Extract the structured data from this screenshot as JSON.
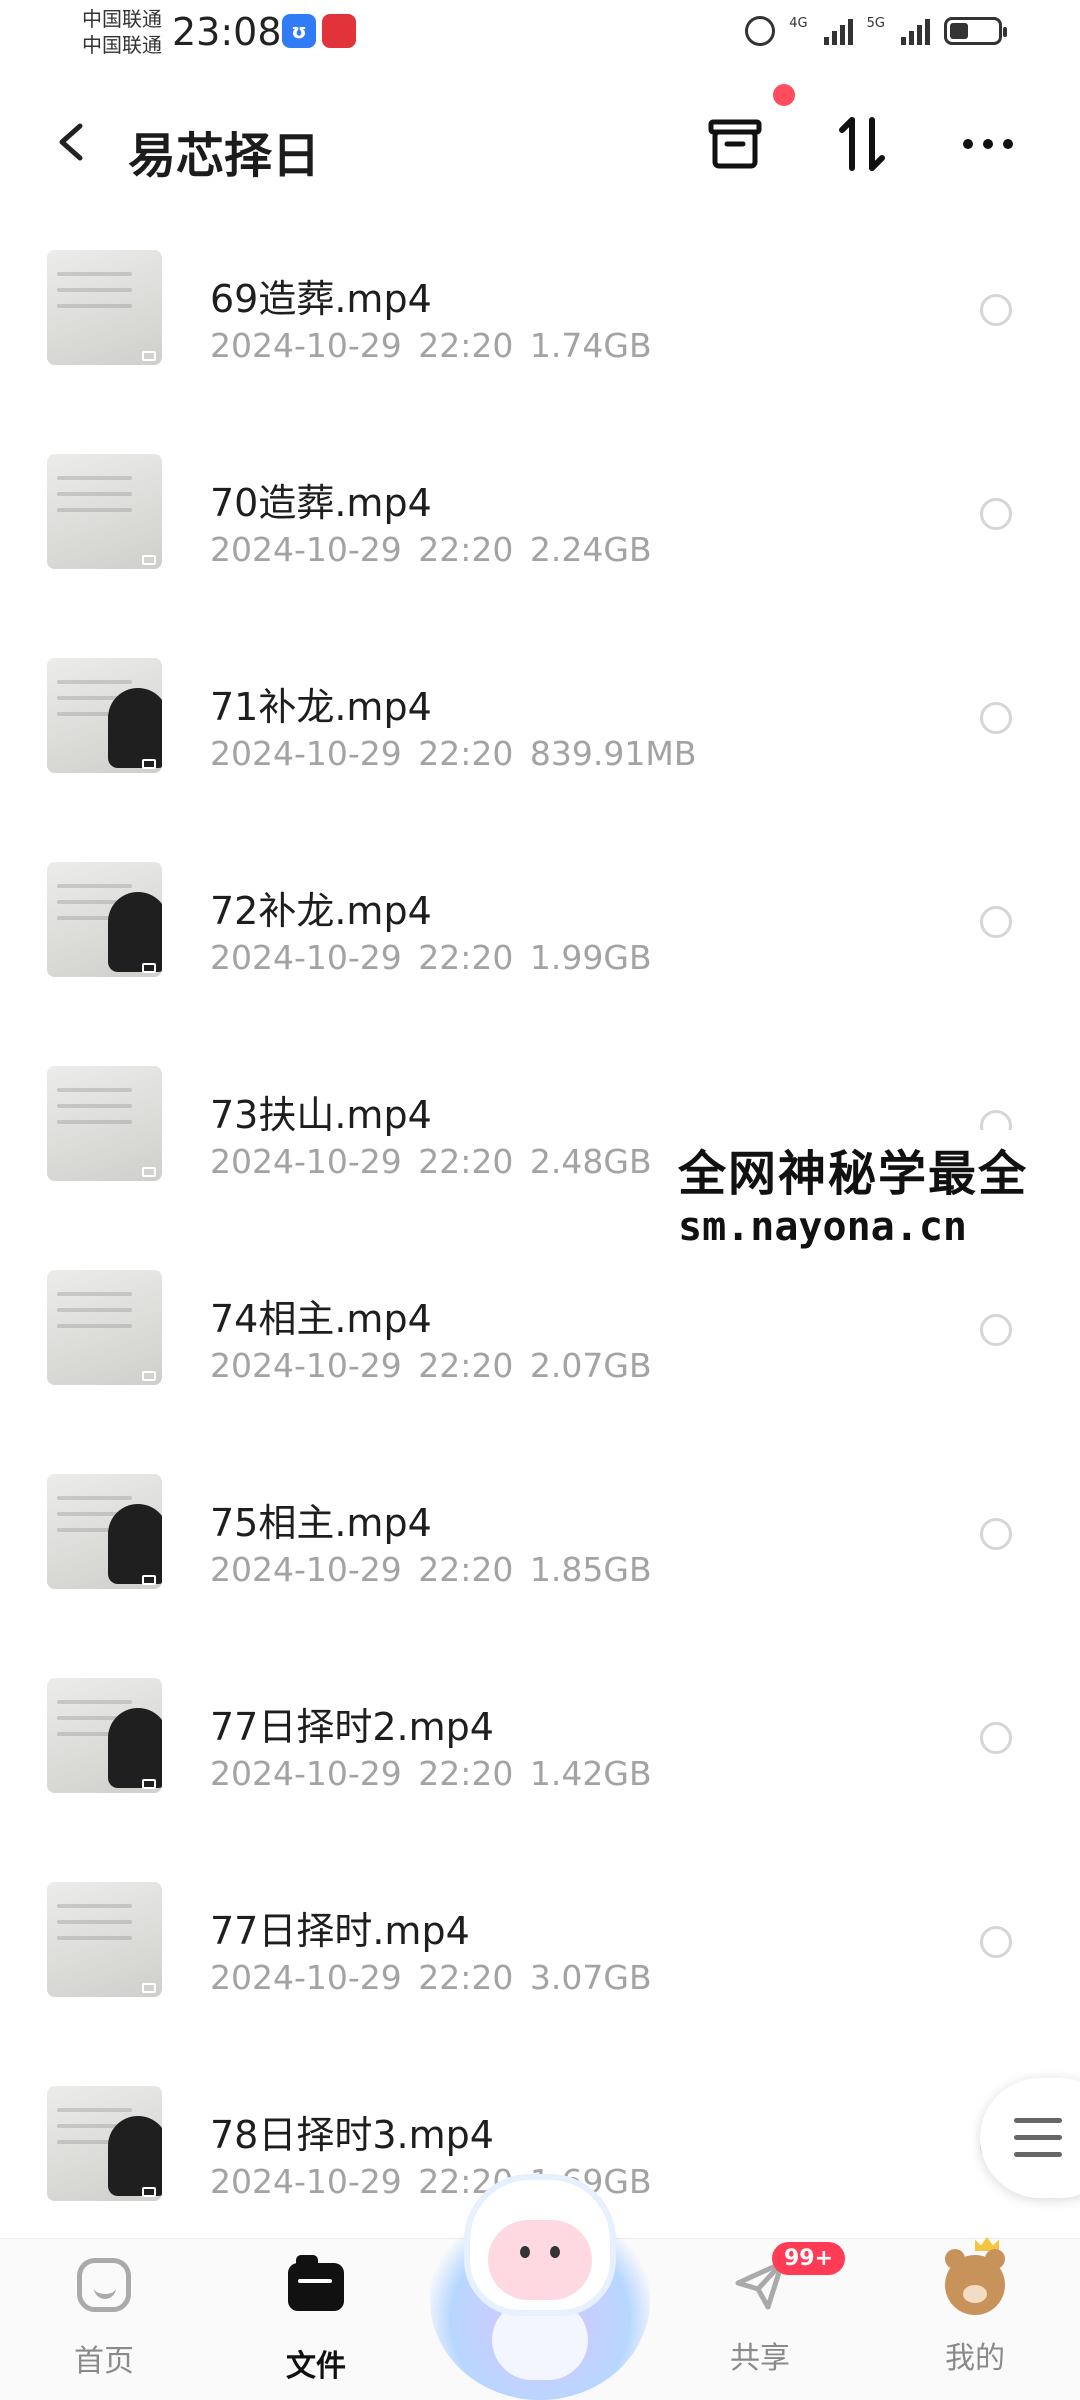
{
  "status_bar": {
    "carrier_1": "中国联通",
    "carrier_2": "中国联通",
    "time": "23:08",
    "network_1": "4G",
    "network_2": "5G",
    "battery_level": 0.35,
    "icons": [
      "alarm-icon",
      "signal-icon",
      "battery-icon"
    ]
  },
  "header": {
    "title": "易芯择日",
    "icons": [
      "back-icon",
      "archive-icon",
      "sort-icon",
      "more-icon"
    ],
    "notification_dot_color": "#ff4d5e"
  },
  "files": [
    {
      "name": "69造葬.mp4",
      "date": "2024-10-29",
      "time": "22:20",
      "size": "1.74GB",
      "thumb": "board"
    },
    {
      "name": "70造葬.mp4",
      "date": "2024-10-29",
      "time": "22:20",
      "size": "2.24GB",
      "thumb": "board"
    },
    {
      "name": "71补龙.mp4",
      "date": "2024-10-29",
      "time": "22:20",
      "size": "839.91MB",
      "thumb": "person"
    },
    {
      "name": "72补龙.mp4",
      "date": "2024-10-29",
      "time": "22:20",
      "size": "1.99GB",
      "thumb": "person"
    },
    {
      "name": "73扶山.mp4",
      "date": "2024-10-29",
      "time": "22:20",
      "size": "2.48GB",
      "thumb": "board"
    },
    {
      "name": "74相主.mp4",
      "date": "2024-10-29",
      "time": "22:20",
      "size": "2.07GB",
      "thumb": "board"
    },
    {
      "name": "75相主.mp4",
      "date": "2024-10-29",
      "time": "22:20",
      "size": "1.85GB",
      "thumb": "person"
    },
    {
      "name": "77日择时2.mp4",
      "date": "2024-10-29",
      "time": "22:20",
      "size": "1.42GB",
      "thumb": "person"
    },
    {
      "name": "77日择时.mp4",
      "date": "2024-10-29",
      "time": "22:20",
      "size": "3.07GB",
      "thumb": "board"
    },
    {
      "name": "78日择时3.mp4",
      "date": "2024-10-29",
      "time": "22:20",
      "size": "1.69GB",
      "thumb": "person"
    }
  ],
  "watermark": {
    "line1": "全网神秘学最全",
    "line2": "sm.nayona.cn"
  },
  "bottom_nav": {
    "items": [
      {
        "label": "首页",
        "icon": "home-icon",
        "active": false
      },
      {
        "label": "文件",
        "icon": "folder-icon",
        "active": true
      },
      {
        "label": "共享",
        "icon": "paper-plane-icon",
        "active": false
      },
      {
        "label": "我的",
        "icon": "bear-avatar-icon",
        "active": false
      }
    ],
    "share_badge": "99+"
  },
  "colors": {
    "badge": "#ff3b55",
    "meta_text": "#a3a3a3",
    "active_nav": "#111111"
  }
}
